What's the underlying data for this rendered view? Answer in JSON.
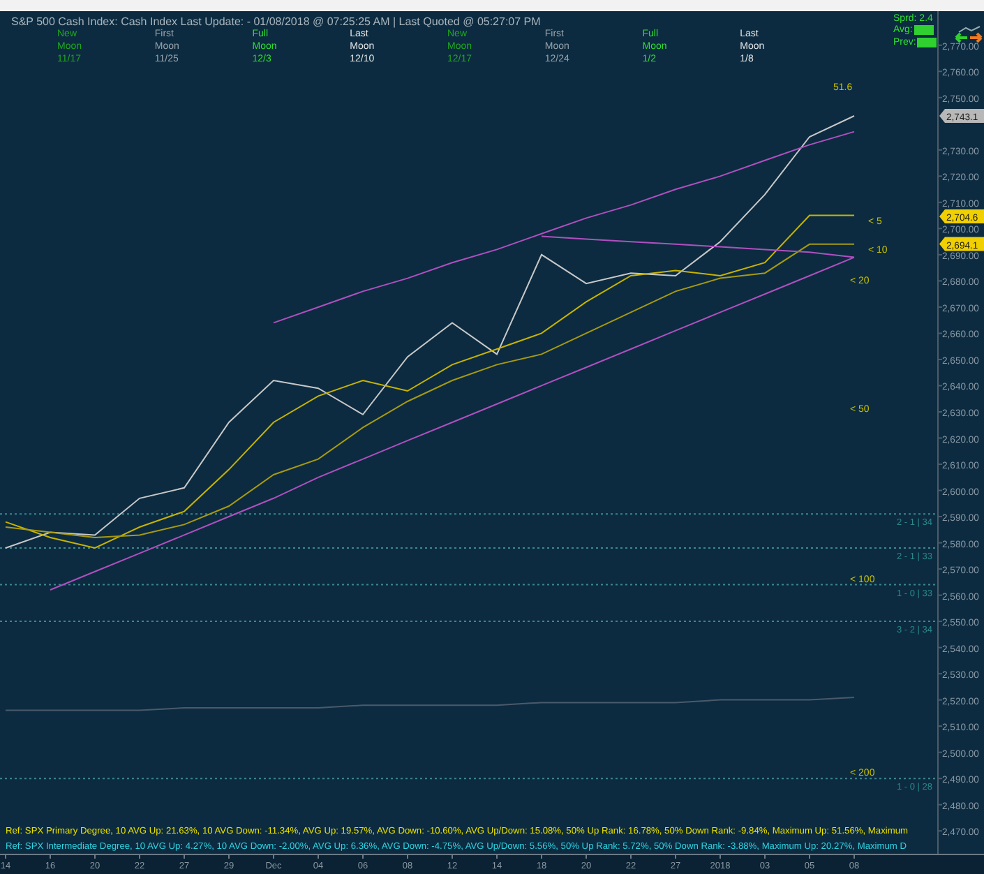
{
  "header": {
    "title": "S&P 500 Cash Index:  Cash Index  Last Update:  - 01/08/2018 @ 07:25:25 AM | Last Quoted @ 05:27:07 PM",
    "moons": [
      {
        "kind": "new",
        "line1": "New",
        "line2": "Moon",
        "date": "11/17"
      },
      {
        "kind": "first",
        "line1": "First",
        "line2": "Moon",
        "date": "11/25"
      },
      {
        "kind": "full",
        "line1": "Full",
        "line2": "Moon",
        "date": "12/3"
      },
      {
        "kind": "last",
        "line1": "Last",
        "line2": "Moon",
        "date": "12/10"
      },
      {
        "kind": "new",
        "line1": "New",
        "line2": "Moon",
        "date": "12/17"
      },
      {
        "kind": "first",
        "line1": "First",
        "line2": "Moon",
        "date": "12/24"
      },
      {
        "kind": "full",
        "line1": "Full",
        "line2": "Moon",
        "date": "1/2"
      },
      {
        "kind": "last",
        "line1": "Last",
        "line2": "Moon",
        "date": "1/8"
      }
    ],
    "spread": [
      {
        "label": "Sprd: 2.4",
        "boxed": false
      },
      {
        "label": "Avg:",
        "boxed": true
      },
      {
        "label": "Prev:",
        "boxed": true
      }
    ]
  },
  "chart": {
    "chart_data": {
      "type": "line",
      "categories": [
        "14",
        "16",
        "20",
        "22",
        "27",
        "29",
        "Dec",
        "04",
        "06",
        "08",
        "12",
        "14",
        "18",
        "20",
        "22",
        "27",
        "2018",
        "03",
        "05",
        "08"
      ],
      "series": [
        {
          "color": "#c8c8c8",
          "values": [
            2578,
            2584,
            2583,
            2597,
            2601,
            2626,
            2642,
            2639,
            2629,
            2651,
            2664,
            2652,
            2690,
            2679,
            2683,
            2682,
            2695,
            2713,
            2735,
            2743
          ]
        },
        {
          "name": "< 5",
          "color": "#c8b400",
          "values": [
            2588,
            2582,
            2578,
            2586,
            2592,
            2608,
            2626,
            2636,
            2642,
            2638,
            2648,
            2654,
            2660,
            2672,
            2682,
            2684,
            2682,
            2687,
            2705,
            2705
          ]
        },
        {
          "name": "< 10",
          "color": "#a89a10",
          "values": [
            2586,
            2584,
            2582,
            2583,
            2587,
            2594,
            2606,
            2612,
            2624,
            2634,
            2642,
            2648,
            2652,
            2660,
            2668,
            2676,
            2681,
            2683,
            2694,
            2694
          ]
        },
        {
          "color": "#b050c0",
          "values": [
            null,
            null,
            null,
            null,
            null,
            null,
            2664,
            2670,
            2676,
            2681,
            2687,
            2692,
            2698,
            2704,
            2709,
            2715,
            2720,
            2726,
            2732,
            2737
          ]
        },
        {
          "color": "#b050c0",
          "values": [
            null,
            2562,
            2569,
            2576,
            2583,
            2590,
            2597,
            2605,
            2612,
            2619,
            2626,
            2633,
            2640,
            2647,
            2654,
            2661,
            2668,
            2675,
            2682,
            2689
          ]
        },
        {
          "color": "#b050c0",
          "values": [
            null,
            null,
            null,
            null,
            null,
            null,
            null,
            null,
            null,
            null,
            null,
            null,
            2697,
            2696,
            2695,
            2694,
            2693,
            2692,
            2691,
            2689
          ]
        },
        {
          "color": "#4a5a6a",
          "values": [
            2516,
            2516,
            2516,
            2516,
            2517,
            2517,
            2517,
            2517,
            2518,
            2518,
            2518,
            2518,
            2519,
            2519,
            2519,
            2519,
            2520,
            2520,
            2520,
            2521
          ]
        }
      ],
      "ylim": [
        2461,
        2783
      ],
      "grid": true,
      "yticks": [
        {
          "value": 2770,
          "label": "2,770.00"
        },
        {
          "value": 2760,
          "label": "2,760.00"
        },
        {
          "value": 2750,
          "label": "2,750.00"
        },
        {
          "value": 2730,
          "label": "2,730.00"
        },
        {
          "value": 2720,
          "label": "2,720.00"
        },
        {
          "value": 2710,
          "label": "2,710.00"
        },
        {
          "value": 2700,
          "label": "2,700.00"
        },
        {
          "value": 2690,
          "label": "2,690.00"
        },
        {
          "value": 2680,
          "label": "2,680.00"
        },
        {
          "value": 2670,
          "label": "2,670.00"
        },
        {
          "value": 2660,
          "label": "2,660.00"
        },
        {
          "value": 2650,
          "label": "2,650.00"
        },
        {
          "value": 2640,
          "label": "2,640.00"
        },
        {
          "value": 2630,
          "label": "2,630.00"
        },
        {
          "value": 2620,
          "label": "2,620.00"
        },
        {
          "value": 2610,
          "label": "2,610.00"
        },
        {
          "value": 2600,
          "label": "2,600.00"
        },
        {
          "value": 2590,
          "label": "2,590.00"
        },
        {
          "value": 2580,
          "label": "2,580.00"
        },
        {
          "value": 2570,
          "label": "2,570.00"
        },
        {
          "value": 2560,
          "label": "2,560.00"
        },
        {
          "value": 2550,
          "label": "2,550.00"
        },
        {
          "value": 2540,
          "label": "2,540.00"
        },
        {
          "value": 2530,
          "label": "2,530.00"
        },
        {
          "value": 2520,
          "label": "2,520.00"
        },
        {
          "value": 2510,
          "label": "2,510.00"
        },
        {
          "value": 2500,
          "label": "2,500.00"
        },
        {
          "value": 2490,
          "label": "2,490.00"
        },
        {
          "value": 2480,
          "label": "2,480.00"
        },
        {
          "value": 2470,
          "label": "2,470.00"
        }
      ],
      "annotations": [
        "51.6",
        "< 20",
        "< 50",
        "< 100",
        "< 200",
        "2 - 1 | 34",
        "2 - 1 | 33",
        "1 - 0 | 33",
        "3 - 2 | 34",
        "1 - 0 | 28"
      ]
    }
  },
  "price_tags": [
    {
      "text": "2,743.1",
      "color": "#b8b8b8"
    },
    {
      "text": "2,704.6",
      "color": "#f0d000"
    },
    {
      "text": "2,694.1",
      "color": "#f0d000"
    }
  ],
  "stats": [
    {
      "kind": "primary",
      "text": "Ref: SPX Primary Degree, 10 AVG Up: 21.63%, 10 AVG Down: -11.34%, AVG Up: 19.57%, AVG Down: -10.60%, AVG Up/Down: 15.08%, 50%  Up Rank: 16.78%, 50% Down Rank: -9.84%, Maximum Up: 51.56%, Maximum"
    },
    {
      "kind": "intermediate",
      "text": "Ref: SPX Intermediate Degree, 10 AVG Up: 4.27%, 10 AVG Down: -2.00%, AVG Up: 6.36%, AVG Down: -4.75%, AVG Up/Down: 5.56%, 50%  Up Rank: 5.72%, 50% Down Rank: -3.88%, Maximum Up: 20.27%, Maximum D"
    }
  ]
}
